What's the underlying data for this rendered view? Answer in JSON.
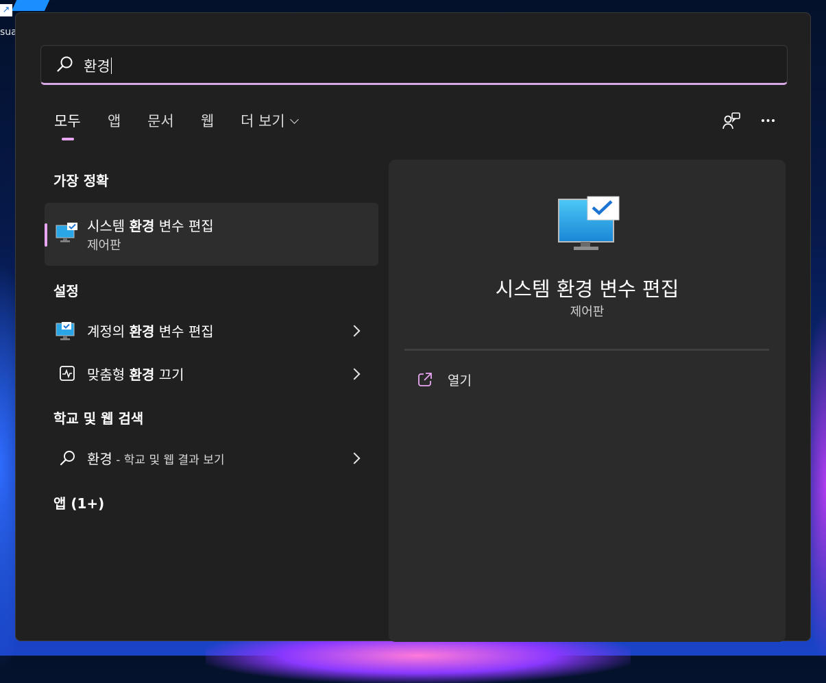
{
  "desktop": {
    "icon_label": "sual C"
  },
  "search": {
    "query": "환경",
    "icon": "search-icon"
  },
  "tabs": [
    {
      "label": "모두",
      "active": true
    },
    {
      "label": "앱",
      "active": false
    },
    {
      "label": "문서",
      "active": false
    },
    {
      "label": "웹",
      "active": false
    },
    {
      "label": "더 보기",
      "active": false
    }
  ],
  "toolbar": {
    "share_icon": "people-feedback-icon",
    "more_icon": "more-ellipsis-icon"
  },
  "sections": {
    "best_match": "가장 정확",
    "settings": "설정",
    "web": "학교 및 웹 검색",
    "apps": "앱 (1+)"
  },
  "best_match": {
    "title_pre": "시스템 ",
    "title_bold": "환경",
    "title_post": " 변수 편집",
    "subtitle": "제어판",
    "icon": "system-monitor-icon"
  },
  "settings_items": [
    {
      "pre": "계정의 ",
      "bold": "환경",
      "post": " 변수 편집",
      "icon": "monitor-check-icon"
    },
    {
      "pre": "맞춤형 ",
      "bold": "환경",
      "post": " 끄기",
      "icon": "activity-icon"
    }
  ],
  "web_item": {
    "query": "환경",
    "suffix": " - 학교 및 웹 결과 보기",
    "icon": "search-icon"
  },
  "preview": {
    "title": "시스템 환경 변수 편집",
    "subtitle": "제어판",
    "actions": [
      {
        "label": "열기",
        "icon": "open-external-icon"
      }
    ]
  },
  "colors": {
    "accent": "#e8a6f2",
    "panel_bg": "#202020",
    "preview_bg": "#2b2b2b",
    "selected_bg": "#2d2d2d"
  }
}
